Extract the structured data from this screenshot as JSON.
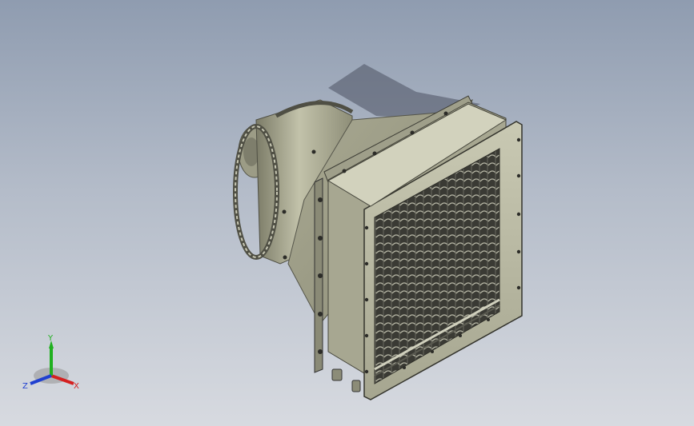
{
  "viewport": {
    "background_top": "#8f9cb0",
    "background_bottom": "#d7dae0",
    "model_color": "#b4b49a"
  },
  "triad": {
    "x_label": "X",
    "y_label": "Y",
    "z_label": "Z",
    "x_color": "#d42020",
    "y_color": "#20b020",
    "z_color": "#2040d0"
  }
}
